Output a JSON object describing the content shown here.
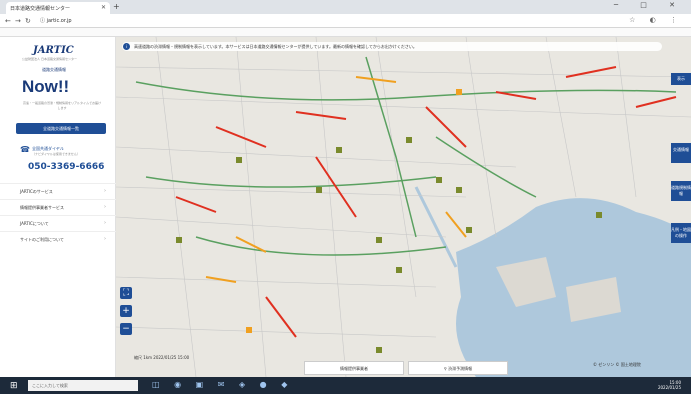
{
  "browser": {
    "tab_title": "日本道路交通情報センター",
    "tab_close": "✕",
    "new_tab": "+",
    "window_controls": "─ □ ✕",
    "nav_back": "←",
    "nav_forward": "→",
    "nav_reload": "↻",
    "url": "ⓘ jartic.or.jp",
    "toolbar_icons": "☆ ◐ ⋮",
    "bookmarks": [
      "アプリ",
      "Yahoo! JAPAN",
      "道路交通情報",
      "Google",
      "YouTube",
      "Gmail",
      "翻訳",
      "地図",
      "ニュース",
      "天気",
      "その他"
    ]
  },
  "sidebar": {
    "logo": "JARTIC",
    "logo_sub": "公益財団法人 日本道路交通情報センター",
    "now_small": "道路交通情報",
    "now_logo": "Now!!",
    "now_desc": "高速・一般道路の渋滞・規制情報をリアルタイムでお届けします",
    "btn_list": "全道路交通情報一覧",
    "phone_label": "全国共通ダイヤル",
    "phone_sub": "（ナビダイヤルは使用できません）",
    "phone_number": "050-3369-6666",
    "menu": [
      {
        "label": "JARTICのサービス"
      },
      {
        "label": "情報提供事業者サービス"
      },
      {
        "label": "JARTICについて"
      },
      {
        "label": "サイトのご利用について"
      }
    ],
    "chevron": "›"
  },
  "map": {
    "banner_icon": "i",
    "banner": "高速道路の渋滞情報・規制情報を表示しています。本サービスは日本道路交通情報センターが提供しています。最新の情報を確認してからお出かけください。",
    "side_buttons": [
      "表示",
      "交通情報",
      "道路規制情報",
      "凡例・地図の操作"
    ],
    "zoom": [
      "⛶",
      "+",
      "−"
    ],
    "scale_label": "縮尺  1km  2022/01/25 15:00",
    "bottom_buttons": [
      "情報提供事業者",
      "⚲  渋滞予測情報"
    ],
    "copyright": "© ゼンリン  © 国土地理院"
  },
  "taskbar": {
    "start": "⊞",
    "search": "ここに入力して検索",
    "apps": "◫ ◉ ▣ ✉ ◈ ● ◆",
    "time": "15:00",
    "date": "2022/01/25"
  },
  "colors": {
    "brand": "#1f4e96",
    "congestion": "#e03020",
    "slow": "#f0a020",
    "flowing": "#5aa060",
    "water": "#aec8dc",
    "land": "#e9e7e1"
  }
}
